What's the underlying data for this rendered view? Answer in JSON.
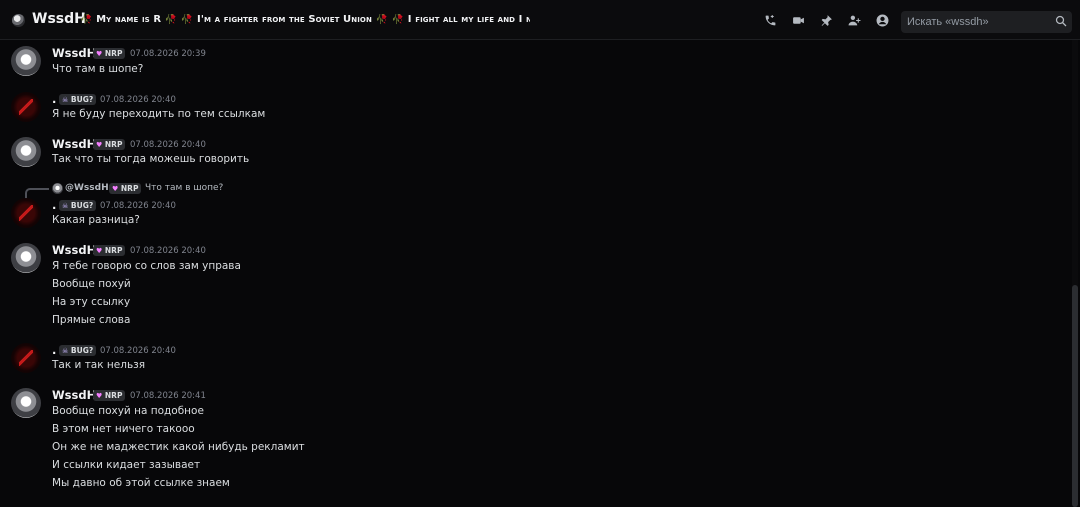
{
  "header": {
    "channel_name": "WssdH",
    "topic": "🥀 My name is R 🥀 🥀 I'm a fighter from the Soviet Union 🥀 🥀 I fight all my life and I never lose 🥀",
    "icons": [
      "phone-call-icon",
      "video-call-icon",
      "pin-icon",
      "add-member-icon",
      "user-profile-icon"
    ],
    "search_placeholder": "Искать «wssdh»"
  },
  "reply": {
    "name": "@WssdH",
    "tag": "NRP",
    "text": "Что там в шопе?"
  },
  "messages": [
    {
      "author": "WssdH",
      "tag": "NRP",
      "timestamp": "07.08.2026 20:39",
      "lines": [
        "Что там в шопе?"
      ]
    },
    {
      "author": ".",
      "tag": "BUG?",
      "timestamp": "07.08.2026 20:40",
      "lines": [
        "Я не буду переходить по тем ссылкам"
      ]
    },
    {
      "author": "WssdH",
      "tag": "NRP",
      "timestamp": "07.08.2026 20:40",
      "lines": [
        "Так что ты тогда можешь говорить"
      ]
    },
    {
      "author": ".",
      "tag": "BUG?",
      "timestamp": "07.08.2026 20:40",
      "lines": [
        "Какая разница?"
      ]
    },
    {
      "author": "WssdH",
      "tag": "NRP",
      "timestamp": "07.08.2026 20:40",
      "lines": [
        "Я тебе говорю со слов зам управа",
        "Вообще похуй",
        "На эту ссылку",
        "Прямые слова"
      ]
    },
    {
      "author": ".",
      "tag": "BUG?",
      "timestamp": "07.08.2026 20:40",
      "lines": [
        "Так и так нельзя"
      ]
    },
    {
      "author": "WssdH",
      "tag": "NRP",
      "timestamp": "07.08.2026 20:41",
      "lines": [
        "Вообще похуй на подобное",
        "В этом нет ничего такооо",
        "Он же не маджестик какой нибудь рекламит",
        "И ссылки кидает зазывает",
        "Мы давно об этой ссылке знаем"
      ]
    }
  ]
}
